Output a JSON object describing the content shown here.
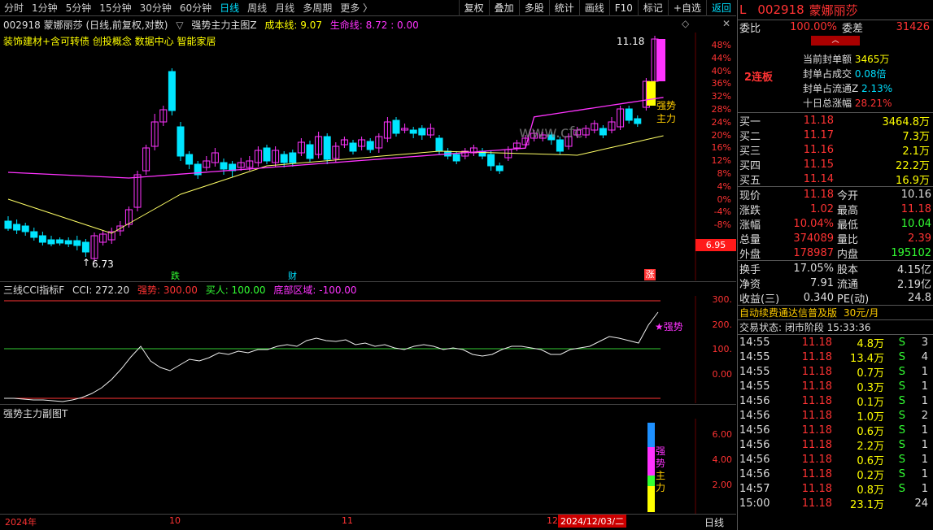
{
  "topbar": {
    "periods": [
      "分时",
      "1分钟",
      "5分钟",
      "15分钟",
      "30分钟",
      "60分钟",
      "日线",
      "周线",
      "月线",
      "多周期",
      "更多 〉"
    ],
    "active_period": "日线",
    "tools": [
      "复权",
      "叠加",
      "多股",
      "统计",
      "画线",
      "F10",
      "标记",
      "+自选",
      "返回"
    ],
    "active_tool": "返回"
  },
  "main_chart": {
    "stock": "002918 蒙娜丽莎 (日线,前复权,对数)",
    "indicator": "强势主力主图Z",
    "cost_line": "成本线: 9.07",
    "life_line": "生命线: 8.72 : 0.00",
    "tags": "装饰建材+含可转债 创投概念 数据中心 智能家居",
    "high_label": "11.18",
    "low_label": "6.73",
    "current_price_tag": "6.95",
    "badge_label_1": "强势",
    "badge_label_2": "主力",
    "watermark": "www.cfc",
    "markers": [
      "跌",
      "财",
      "涨"
    ],
    "y_ticks": [
      "48%",
      "44%",
      "40%",
      "36%",
      "32%",
      "28%",
      "24%",
      "20%",
      "16%",
      "12%",
      "8%",
      "4%",
      "0%",
      "-4%",
      "-8%"
    ]
  },
  "cci_panel": {
    "title": "三线CCI指标F",
    "cci": "CCI: 272.20",
    "strong": "强势: 300.00",
    "buy": "买人: 100.00",
    "bottom": "底部区域: -100.00",
    "label": "强势",
    "y_ticks": [
      "300.",
      "200.",
      "100.",
      "0.00"
    ]
  },
  "sub_panel": {
    "title": "强势主力副图T",
    "y_ticks": [
      "6.00",
      "4.00",
      "2.00"
    ],
    "vertical_text": [
      "强",
      "势",
      "主",
      "力"
    ]
  },
  "x_axis": {
    "labels": [
      "2024年",
      "10",
      "11",
      "12"
    ],
    "date_tag": "2024/12/03/二",
    "period_tag": "日线"
  },
  "right_panel": {
    "code": "002918",
    "name": "蒙娜丽莎",
    "weibi_label": "委比",
    "weibi": "100.00%",
    "weicha_label": "委差",
    "weicha": "31426",
    "lianban": "2连板",
    "seal": [
      {
        "label": "当前封单额",
        "value": "3465万"
      },
      {
        "label": "封单占成交",
        "value": "0.08倍"
      },
      {
        "label": "封单占流通Z",
        "value": "2.13%"
      },
      {
        "label": "十日总涨幅",
        "value": "28.21%"
      }
    ],
    "bids": [
      {
        "label": "买一",
        "price": "11.18",
        "vol": "3464.8万"
      },
      {
        "label": "买二",
        "price": "11.17",
        "vol": "7.3万"
      },
      {
        "label": "买三",
        "price": "11.16",
        "vol": "2.1万"
      },
      {
        "label": "买四",
        "price": "11.15",
        "vol": "22.2万"
      },
      {
        "label": "买五",
        "price": "11.14",
        "vol": "16.9万"
      }
    ],
    "quote": [
      {
        "l1": "现价",
        "v1": "11.18",
        "l2": "今开",
        "v2": "10.16"
      },
      {
        "l1": "涨跌",
        "v1": "1.02",
        "l2": "最高",
        "v2": "11.18"
      },
      {
        "l1": "涨幅",
        "v1": "10.04%",
        "l2": "最低",
        "v2": "10.04"
      },
      {
        "l1": "总量",
        "v1": "374089",
        "l2": "量比",
        "v2": "2.39"
      },
      {
        "l1": "外盘",
        "v1": "178987",
        "l2": "内盘",
        "v2": "195102"
      }
    ],
    "fund": [
      {
        "l1": "换手",
        "v1": "17.05%",
        "l2": "股本",
        "v2": "4.15亿"
      },
      {
        "l1": "净资",
        "v1": "7.91",
        "l2": "流通",
        "v2": "2.19亿"
      },
      {
        "l1": "收益(三)",
        "v1": "0.340",
        "l2": "PE(动)",
        "v2": "24.8"
      }
    ],
    "ad_text": "自动续费通达信普及版",
    "ad_price": "30元/月",
    "status": "交易状态: 闭市阶段 15:33:36",
    "trades": [
      {
        "t": "14:55",
        "p": "11.18",
        "v": "4.8万",
        "s": "S",
        "n": "3"
      },
      {
        "t": "14:55",
        "p": "11.18",
        "v": "13.4万",
        "s": "S",
        "n": "4"
      },
      {
        "t": "14:55",
        "p": "11.18",
        "v": "0.7万",
        "s": "S",
        "n": "1"
      },
      {
        "t": "14:55",
        "p": "11.18",
        "v": "0.3万",
        "s": "S",
        "n": "1"
      },
      {
        "t": "14:56",
        "p": "11.18",
        "v": "0.1万",
        "s": "S",
        "n": "1"
      },
      {
        "t": "14:56",
        "p": "11.18",
        "v": "1.0万",
        "s": "S",
        "n": "2"
      },
      {
        "t": "14:56",
        "p": "11.18",
        "v": "0.6万",
        "s": "S",
        "n": "1"
      },
      {
        "t": "14:56",
        "p": "11.18",
        "v": "2.2万",
        "s": "S",
        "n": "1"
      },
      {
        "t": "14:56",
        "p": "11.18",
        "v": "0.6万",
        "s": "S",
        "n": "1"
      },
      {
        "t": "14:56",
        "p": "11.18",
        "v": "0.2万",
        "s": "S",
        "n": "1"
      },
      {
        "t": "14:57",
        "p": "11.18",
        "v": "0.8万",
        "s": "S",
        "n": "1"
      },
      {
        "t": "15:00",
        "p": "11.18",
        "v": "23.1万",
        "s": "",
        "n": "24"
      }
    ]
  },
  "colors": {
    "up": "#ff33ff",
    "down": "#00e5ff",
    "yellow": "#ffff00",
    "red": "#ff3333",
    "green": "#33ff33",
    "magenta_line": "#ff33ff",
    "bull_bar": "#ffff00"
  }
}
